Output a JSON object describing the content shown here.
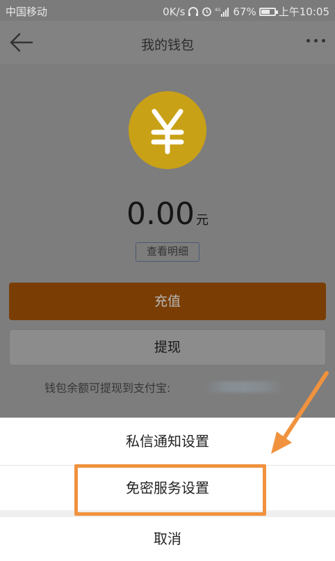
{
  "status_bar": {
    "carrier": "中国移动",
    "speed": "0K/s",
    "battery_percent": "67%",
    "time": "上午10:05",
    "battery_level": 0.67
  },
  "header": {
    "title": "我的钱包"
  },
  "wallet": {
    "coin_symbol": "¥",
    "amount": "0.00",
    "unit": "元",
    "detail_label": "查看明细",
    "recharge_label": "充值",
    "withdraw_label": "提现",
    "hint": "钱包余额可提现到支付宝:"
  },
  "sheet": {
    "items": [
      {
        "label": "私信通知设置"
      },
      {
        "label": "免密服务设置"
      },
      {
        "label": "取消"
      }
    ]
  },
  "colors": {
    "coin": "#c9a116",
    "recharge": "#7a3e04",
    "highlight": "#f0923e"
  },
  "icons": {
    "back": "arrow-left-icon",
    "more": "more-dots-icon",
    "coin": "yen-coin-icon"
  }
}
